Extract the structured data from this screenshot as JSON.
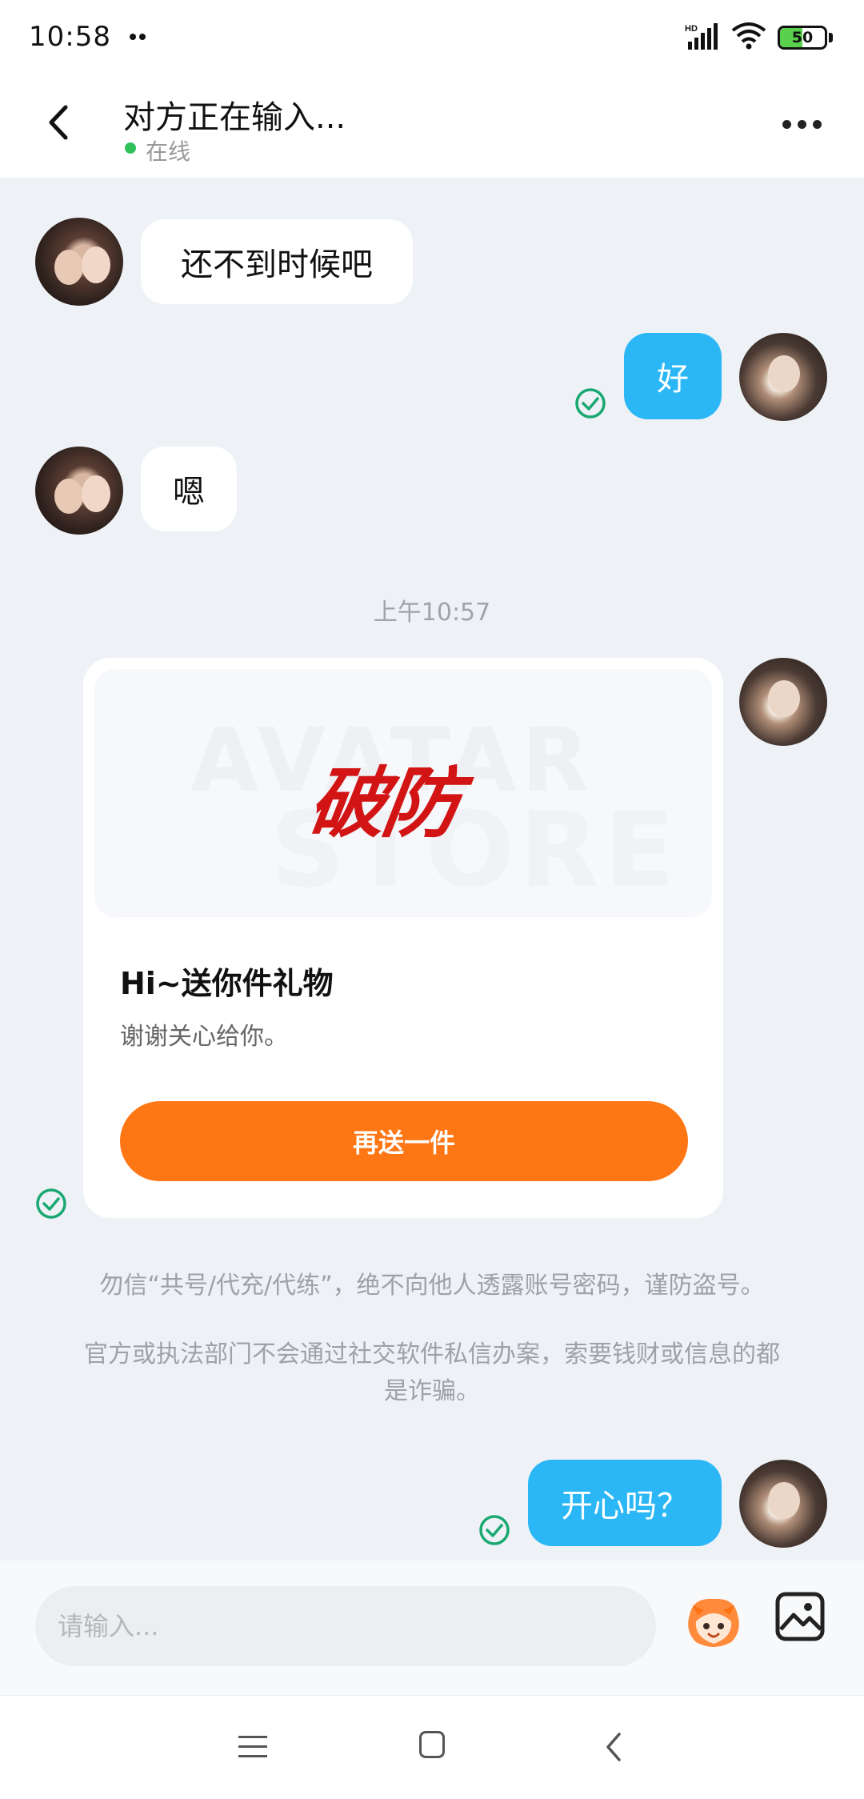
{
  "status_bar": {
    "time": "10:58",
    "network_label": "HD",
    "battery_level": "50",
    "battery_fill_percent": 50
  },
  "header": {
    "title": "对方正在输入...",
    "status": "在线"
  },
  "messages": [
    {
      "side": "in",
      "text": "还不到时候吧"
    },
    {
      "side": "out",
      "text": "好"
    },
    {
      "side": "in",
      "text": "嗯"
    }
  ],
  "time_divider": "上午10:57",
  "gift_card": {
    "image_text": "破防",
    "watermark": [
      "AVATAR",
      "STORE"
    ],
    "title": "Hi~送你件礼物",
    "description": "谢谢关心给你。",
    "button_label": "再送一件"
  },
  "notices": [
    "勿信“共号/代充/代练”，绝不向他人透露账号密码，谨防盗号。",
    "官方或执法部门不会通过社交软件私信办案，索要钱财或信息的都是诈骗。"
  ],
  "last_message": {
    "side": "out",
    "text": "开心吗？"
  },
  "input": {
    "placeholder": "请输入..."
  },
  "colors": {
    "outgoing_bubble": "#2bb7f6",
    "gift_button": "#ff7614",
    "online_dot": "#31c15b",
    "check_mark": "#1aa872"
  }
}
